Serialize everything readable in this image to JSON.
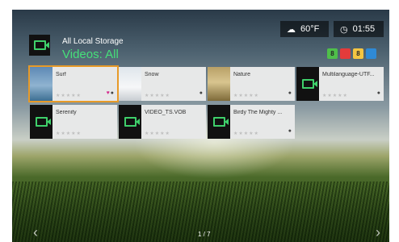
{
  "status": {
    "weather_icon": "cloud-icon",
    "temperature": "60°F",
    "clock_icon": "clock-icon",
    "time": "01:55"
  },
  "header": {
    "source": "All Local Storage",
    "section": "Videos: All"
  },
  "color_buttons": [
    {
      "label": "8",
      "color": "#4fbf4a"
    },
    {
      "label": "",
      "color": "#e33b3b"
    },
    {
      "label": "8",
      "color": "#f4c542"
    },
    {
      "label": "",
      "color": "#2f8ad6"
    }
  ],
  "tiles": [
    {
      "title": "Surf",
      "thumb": "surf",
      "flags": "♥●"
    },
    {
      "title": "Snow",
      "thumb": "snow",
      "flags": "●"
    },
    {
      "title": "Nature",
      "thumb": "nature",
      "flags": "●"
    },
    {
      "title": "Multilanguage-UTF...",
      "thumb": "video-icon",
      "flags": "●"
    },
    {
      "title": "Serenity",
      "thumb": "video-icon",
      "flags": ""
    },
    {
      "title": "VIDEO_TS.VOB",
      "thumb": "video-icon",
      "flags": ""
    },
    {
      "title": "Birdy The Mighty ...",
      "thumb": "video-icon",
      "flags": "●"
    }
  ],
  "stars": "★★★★★",
  "pager": "1 / 7",
  "nav": {
    "prev": "‹",
    "next": "›"
  }
}
